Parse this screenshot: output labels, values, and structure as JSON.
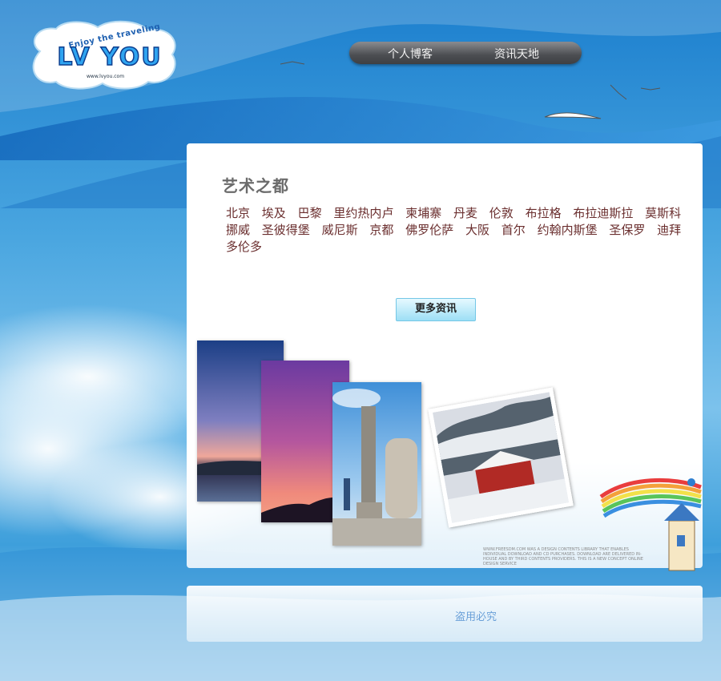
{
  "logo": {
    "slogan": "Enjoy the traveling",
    "title": "LV YOU",
    "url": "www.lvyou.com"
  },
  "nav": {
    "items": [
      "个人博客",
      "资讯天地"
    ]
  },
  "main": {
    "title": "艺术之都",
    "cities": [
      "北京",
      "埃及",
      "巴黎",
      "里约热内卢",
      "柬埔寨",
      "丹麦",
      "伦敦",
      "布拉格",
      "布拉迪斯拉",
      "莫斯科",
      "挪威",
      "圣彼得堡",
      "威尼斯",
      "京都",
      "佛罗伦萨",
      "大阪",
      "首尔",
      "约翰内斯堡",
      "圣保罗",
      "迪拜",
      "多伦多"
    ],
    "more_button": "更多资讯",
    "fine_print": "WWW.FREESDM.COM WAS A DESIGN CONTENTS LIBRARY THAT ENABLES INDIVIDUAL DOWNLOAD AND CD PURCHASES. DOWNLOAD ARE DELIVERED IN-HOUSE AND BY THIRD CONTENTS PROVIDERS. THIS IS A NEW CONCEPT ONLINE DESIGN SERVICE"
  },
  "footer": {
    "text": "盗用必究"
  },
  "colors": {
    "sky": "#3f98d8",
    "city_text": "#6a2e2e",
    "title_text": "#6b6b6b",
    "nav_bg": "#55575b",
    "button_bg": "#aee6f7"
  }
}
